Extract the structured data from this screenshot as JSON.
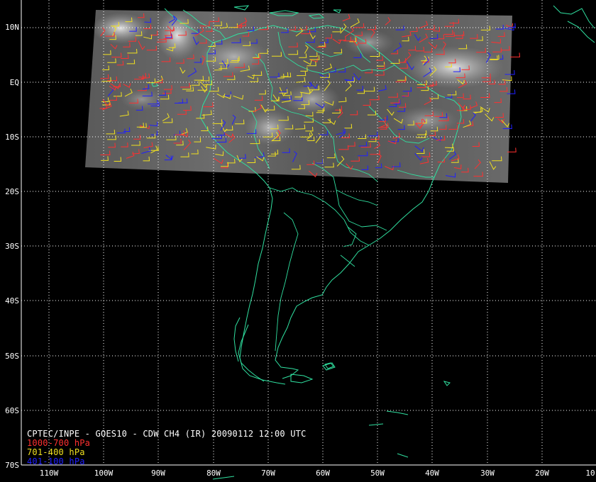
{
  "caption": {
    "title": "CPTEC/INPE - GOES10 - CDW CH4 (IR) 20090112 12:00 UTC",
    "legend": [
      {
        "label": "1000-700 hPa",
        "color": "#ff3030"
      },
      {
        "label": "701-400 hPa",
        "color": "#f0e020"
      },
      {
        "label": "401-100 hPa",
        "color": "#2020ff"
      }
    ]
  },
  "map": {
    "lat_labels": [
      "10N",
      "EQ",
      "10S",
      "20S",
      "30S",
      "40S",
      "50S",
      "60S",
      "70S"
    ],
    "lon_labels": [
      "110W",
      "100W",
      "90W",
      "80W",
      "70W",
      "60W",
      "50W",
      "40W",
      "30W",
      "20W",
      "10"
    ],
    "coastline_color": "#30e0a0",
    "grid_color": "#ffffff"
  }
}
